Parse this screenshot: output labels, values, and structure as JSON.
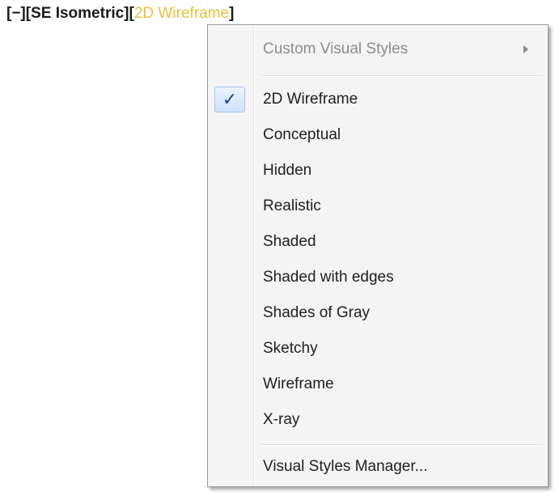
{
  "viewport_controls": {
    "minus_label": "[−]",
    "view_label": "[SE Isometric]",
    "visual_style_open": "[",
    "visual_style_label": "2D Wireframe",
    "visual_style_close": "]",
    "visual_style_color": "#e6c23c"
  },
  "menu": {
    "submenu": {
      "label": "Custom Visual Styles",
      "arrow_icon": "chevron-right-icon"
    },
    "checked_icon": "checkmark-icon",
    "checkmark_glyph": "✓",
    "items": [
      {
        "label": "2D Wireframe",
        "checked": true
      },
      {
        "label": "Conceptual",
        "checked": false
      },
      {
        "label": "Hidden",
        "checked": false
      },
      {
        "label": "Realistic",
        "checked": false
      },
      {
        "label": "Shaded",
        "checked": false
      },
      {
        "label": "Shaded with edges",
        "checked": false
      },
      {
        "label": "Shades of Gray",
        "checked": false
      },
      {
        "label": "Sketchy",
        "checked": false
      },
      {
        "label": "Wireframe",
        "checked": false
      },
      {
        "label": "X-ray",
        "checked": false
      }
    ],
    "manager_label": "Visual Styles Manager..."
  }
}
